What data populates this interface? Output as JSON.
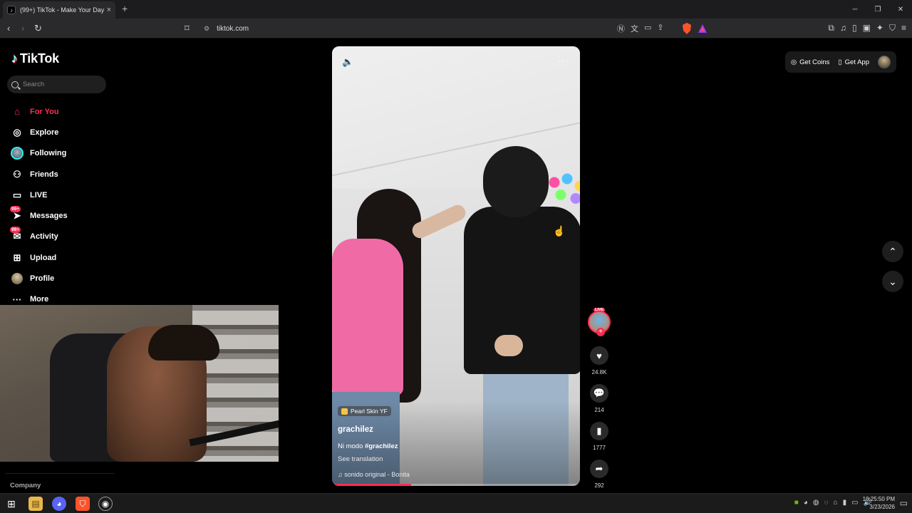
{
  "browser": {
    "tab_title": "(99+) TikTok - Make Your Day",
    "url": "tiktok.com",
    "winctl": {
      "minimize": "─",
      "restore": "❐",
      "close": "✕"
    }
  },
  "app": {
    "logo_text": "TikTok",
    "search_placeholder": "Search"
  },
  "nav": {
    "items": [
      {
        "label": "For You"
      },
      {
        "label": "Explore"
      },
      {
        "label": "Following"
      },
      {
        "label": "Friends"
      },
      {
        "label": "LIVE"
      },
      {
        "label": "Messages",
        "badge": "99+"
      },
      {
        "label": "Activity",
        "badge": "99+"
      },
      {
        "label": "Upload"
      },
      {
        "label": "Profile"
      },
      {
        "label": "More"
      }
    ]
  },
  "footer": {
    "company": "Company"
  },
  "header_actions": {
    "get_coins": "Get Coins",
    "get_app": "Get App"
  },
  "video": {
    "tag": "Pearl Skin YF",
    "username": "grachilez",
    "desc_text": "Ni modo ",
    "hashtag": "#grachilez",
    "see_translation": "See translation",
    "music": "sonido original - Bonita",
    "progress": 0.32
  },
  "actions": {
    "live_label": "LIVE",
    "likes": "24.8K",
    "comments": "214",
    "saves": "1777",
    "shares": "292"
  },
  "taskbar": {
    "time": "10:25:50 PM",
    "date": "3/23/2026"
  },
  "colors": {
    "accent": "#fe2c55",
    "cyan": "#25f4ee",
    "background": "#000000"
  }
}
